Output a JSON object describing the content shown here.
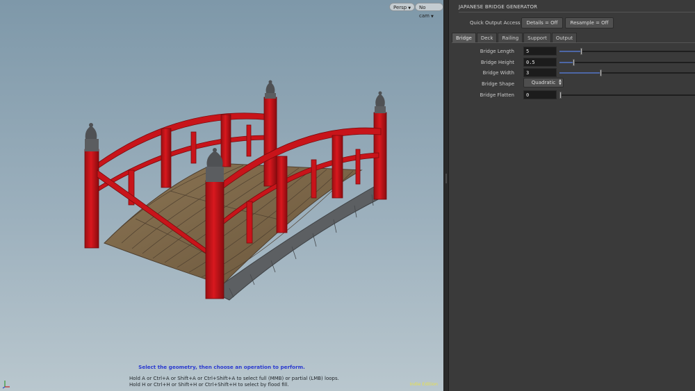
{
  "viewport": {
    "persp_label": "Persp",
    "cam_label": "No cam",
    "status_hint": "Select the geometry, then choose an operation to perform.",
    "help_line_1": "Hold A or Ctrl+A or Shift+A or Ctrl+Shift+A to select full (MMB) or partial (LMB) loops.",
    "help_line_2": "Hold H or Ctrl+H or Shift+H or Ctrl+Shift+H to select by flood fill.",
    "edition": "Indie Edition"
  },
  "panel": {
    "title": "JAPANESE BRIDGE GENERATOR",
    "quick_output_label": "Quick Output Access",
    "details_button": "Details = Off",
    "resample_button": "Resample = Off",
    "tabs": [
      {
        "label": "Bridge",
        "active": true
      },
      {
        "label": "Deck",
        "active": false
      },
      {
        "label": "Railing",
        "active": false
      },
      {
        "label": "Support",
        "active": false
      },
      {
        "label": "Output",
        "active": false
      }
    ],
    "params": {
      "length": {
        "label": "Bridge Length",
        "value": "5",
        "slider_level": 0.16
      },
      "height": {
        "label": "Bridge Height",
        "value": "0.5",
        "slider_level": 0.1
      },
      "width": {
        "label": "Bridge Width",
        "value": "3",
        "slider_level": 0.3
      },
      "shape": {
        "label": "Bridge Shape",
        "value": "Quadratic"
      },
      "flatten": {
        "label": "Bridge Flatten",
        "value": "0",
        "slider_level": 0.0
      }
    }
  },
  "colors": {
    "railing_red": "#c8141a",
    "deck_wood": "#7a6548",
    "stone": "#5a5a5a",
    "slider_fill": "#4d67a6",
    "hint_blue": "#2a3ad0",
    "edition_yellow": "#e8e04a"
  }
}
